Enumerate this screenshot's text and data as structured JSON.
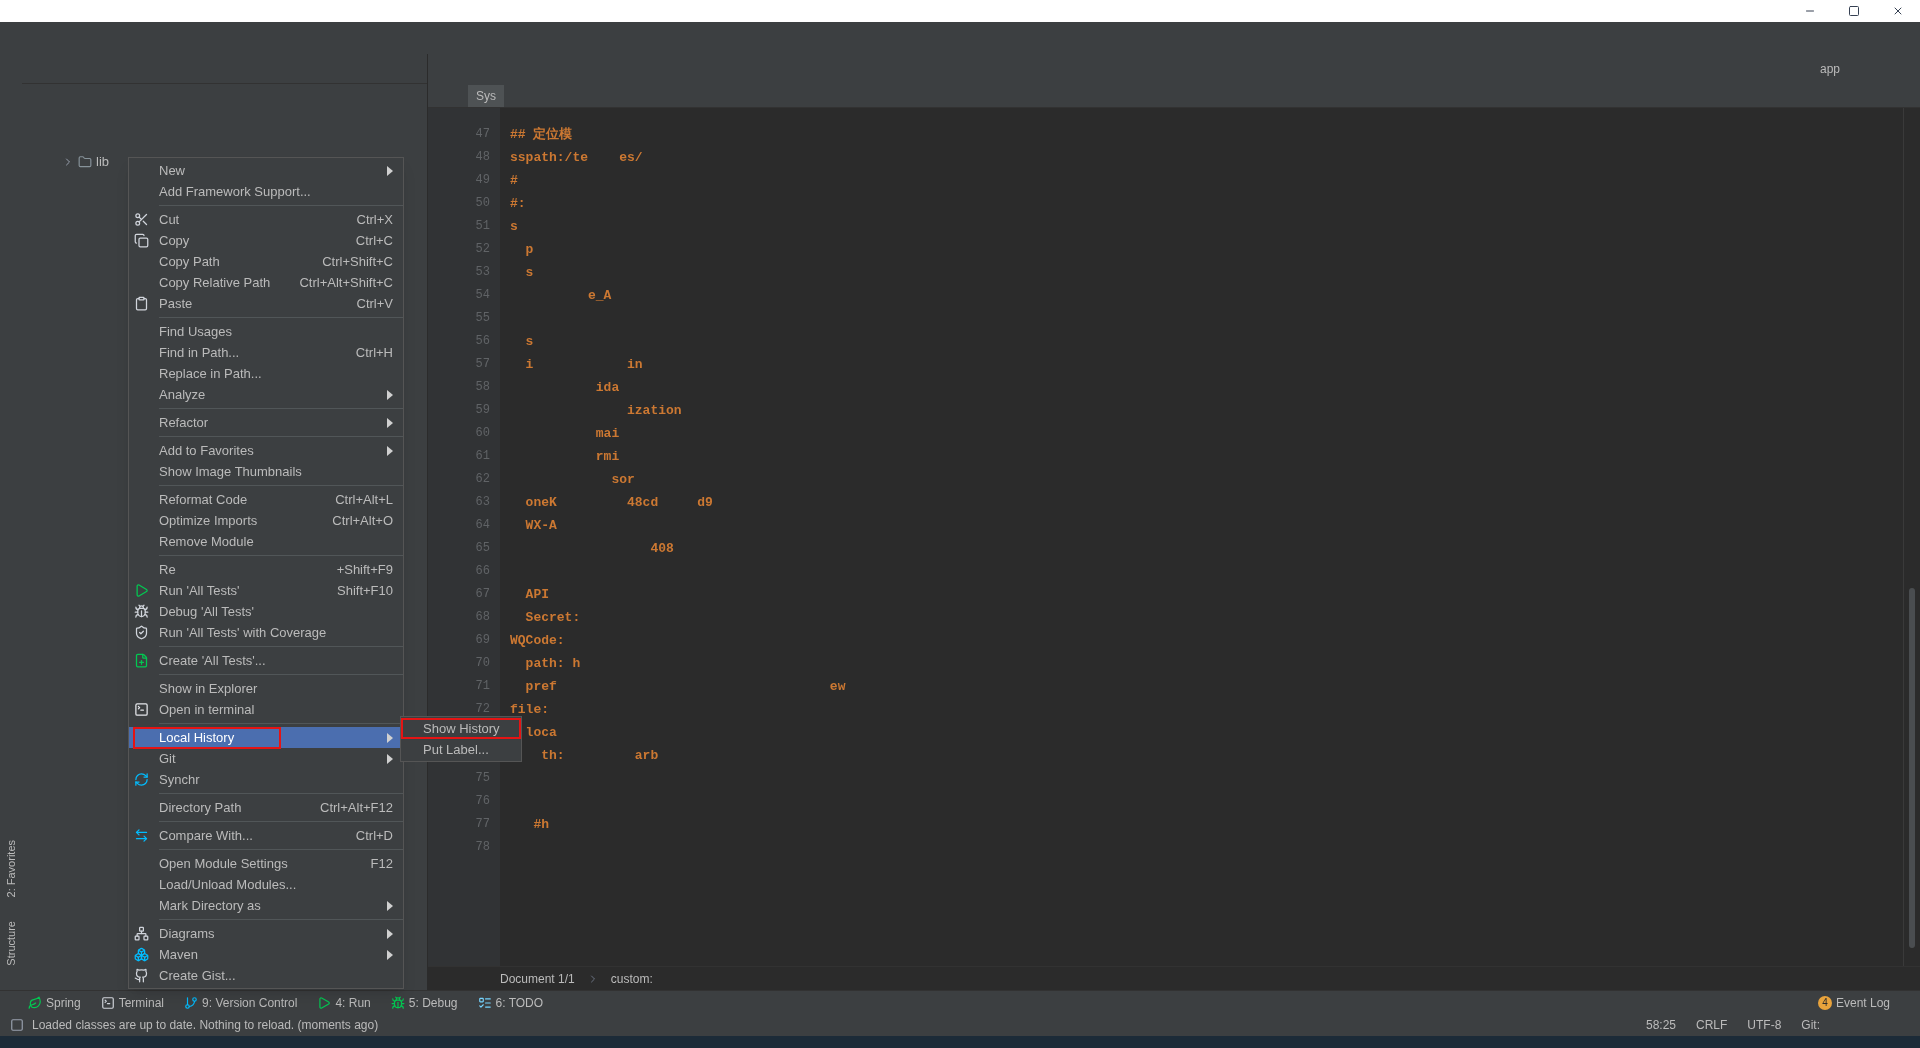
{
  "side_strip": [
    {
      "label": "2: Favorites"
    },
    {
      "label": "Structure"
    }
  ],
  "project_tree": [
    {
      "label": "lib",
      "expanded": false
    }
  ],
  "editor": {
    "tab": "Sys",
    "right_label": "app",
    "lines": [
      {
        "number": "47",
        "text": "## 定位模"
      },
      {
        "number": "48",
        "text": "sspath:/te    es/"
      },
      {
        "number": "49",
        "text": "#"
      },
      {
        "number": "50",
        "text": "#:"
      },
      {
        "number": "51",
        "text": "s"
      },
      {
        "number": "52",
        "text": "  p"
      },
      {
        "number": "53",
        "text": "  s"
      },
      {
        "number": "54",
        "text": "          e_A"
      },
      {
        "number": "55"
      },
      {
        "number": "56",
        "text": "  s"
      },
      {
        "number": "57",
        "text": "  i            in"
      },
      {
        "number": "58",
        "text": "           ida"
      },
      {
        "number": "59",
        "text": "               ization"
      },
      {
        "number": "60",
        "text": "           mai"
      },
      {
        "number": "61",
        "text": "           rmi"
      },
      {
        "number": "62",
        "text": "             sor"
      },
      {
        "number": "63",
        "text": "  oneK         48cd     d9"
      },
      {
        "number": "64",
        "text": "  WX-A"
      },
      {
        "number": "65",
        "text": "                  408"
      },
      {
        "number": "66"
      },
      {
        "number": "67",
        "text": "  API"
      },
      {
        "number": "68",
        "text": "  Secret:"
      },
      {
        "number": "69",
        "text": "WQCode:"
      },
      {
        "number": "70",
        "text": "  path: h"
      },
      {
        "number": "71",
        "text": "  pref                                   ew"
      },
      {
        "number": "72",
        "text": "file:"
      },
      {
        "text": "  loca"
      },
      {
        "text": "    th:         arb"
      },
      {
        "number": "75"
      },
      {
        "number": "76"
      },
      {
        "number": "77",
        "text": "   #h"
      },
      {
        "number": "78"
      }
    ],
    "breadcrumbs": [
      "Document 1/1",
      "custom:"
    ]
  },
  "context_menu": [
    {
      "kind": "item",
      "label": "New",
      "submenu": true,
      "selected": false,
      "marked": false
    },
    {
      "kind": "item",
      "label": "Add Framework Support...",
      "selected": false,
      "marked": false
    },
    {
      "kind": "separator"
    },
    {
      "kind": "item",
      "label": "Cut",
      "shortcut": "Ctrl+X",
      "selected": false,
      "marked": false
    },
    {
      "kind": "item",
      "label": "Copy",
      "shortcut": "Ctrl+C",
      "selected": false,
      "marked": false
    },
    {
      "kind": "item",
      "label": "Copy Path",
      "shortcut": "Ctrl+Shift+C",
      "selected": false,
      "marked": false
    },
    {
      "kind": "item",
      "label": "Copy Relative Path",
      "shortcut": "Ctrl+Alt+Shift+C",
      "selected": false,
      "marked": false
    },
    {
      "kind": "item",
      "label": "Paste",
      "shortcut": "Ctrl+V",
      "selected": false,
      "marked": false
    },
    {
      "kind": "separator"
    },
    {
      "kind": "item",
      "label": "Find Usages",
      "selected": false,
      "marked": false
    },
    {
      "kind": "item",
      "label": "Find in Path...",
      "shortcut": "Ctrl+H",
      "selected": false,
      "marked": false
    },
    {
      "kind": "item",
      "label": "Replace in Path...",
      "selected": false,
      "marked": false
    },
    {
      "kind": "item",
      "label": "Analyze",
      "submenu": true,
      "selected": false,
      "marked": false
    },
    {
      "kind": "separator"
    },
    {
      "kind": "item",
      "label": "Refactor",
      "submenu": true,
      "selected": false,
      "marked": false
    },
    {
      "kind": "separator"
    },
    {
      "kind": "item",
      "label": "Add to Favorites",
      "submenu": true,
      "selected": false,
      "marked": false
    },
    {
      "kind": "item",
      "label": "Show Image Thumbnails",
      "selected": false,
      "marked": false
    },
    {
      "kind": "separator"
    },
    {
      "kind": "item",
      "label": "Reformat Code",
      "shortcut": "Ctrl+Alt+L",
      "selected": false,
      "marked": false
    },
    {
      "kind": "item",
      "label": "Optimize Imports",
      "shortcut": "Ctrl+Alt+O",
      "selected": false,
      "marked": false
    },
    {
      "kind": "item",
      "label": "Remove Module",
      "selected": false,
      "marked": false
    },
    {
      "kind": "separator"
    },
    {
      "kind": "item",
      "label": "Re",
      "shortcut": "+Shift+F9",
      "selected": false,
      "marked": false
    },
    {
      "kind": "item",
      "label": "Run 'All Tests'",
      "shortcut": "Shift+F10",
      "selected": false,
      "marked": false
    },
    {
      "kind": "item",
      "label": "Debug 'All Tests'",
      "selected": false,
      "marked": false
    },
    {
      "kind": "item",
      "label": "Run 'All Tests' with Coverage",
      "selected": false,
      "marked": false
    },
    {
      "kind": "separator"
    },
    {
      "kind": "item",
      "label": "Create 'All Tests'...",
      "selected": false,
      "marked": false
    },
    {
      "kind": "separator"
    },
    {
      "kind": "item",
      "label": "Show in Explorer",
      "selected": false,
      "marked": false
    },
    {
      "kind": "item",
      "label": "Open in terminal",
      "selected": false,
      "marked": false
    },
    {
      "kind": "separator"
    },
    {
      "kind": "item",
      "label": "Local History",
      "submenu": true,
      "selected": true,
      "marked": true
    },
    {
      "kind": "item",
      "label": "Git",
      "submenu": true,
      "selected": false,
      "marked": false
    },
    {
      "kind": "item",
      "label": "Synchr",
      "selected": false,
      "marked": false
    },
    {
      "kind": "separator"
    },
    {
      "kind": "item",
      "label": "Directory Path",
      "shortcut": "Ctrl+Alt+F12",
      "selected": false,
      "marked": false
    },
    {
      "kind": "separator"
    },
    {
      "kind": "item",
      "label": "Compare With...",
      "shortcut": "Ctrl+D",
      "selected": false,
      "marked": false
    },
    {
      "kind": "separator"
    },
    {
      "kind": "item",
      "label": "Open Module Settings",
      "shortcut": "F12",
      "selected": false,
      "marked": false
    },
    {
      "kind": "item",
      "label": "Load/Unload Modules...",
      "selected": false,
      "marked": false
    },
    {
      "kind": "item",
      "label": "Mark Directory as",
      "submenu": true,
      "selected": false,
      "marked": false
    },
    {
      "kind": "separator"
    },
    {
      "kind": "item",
      "label": "Diagrams",
      "submenu": true,
      "selected": false,
      "marked": false
    },
    {
      "kind": "item",
      "label": "Maven",
      "submenu": true,
      "selected": false,
      "marked": false
    },
    {
      "kind": "item",
      "label": "Create Gist...",
      "selected": false,
      "marked": false
    }
  ],
  "submenu": [
    {
      "label": "Show History",
      "selected": false,
      "marked": true
    },
    {
      "label": "Put Label...",
      "selected": false,
      "marked": false
    }
  ],
  "tool_windows": [
    {
      "label": "Spring"
    },
    {
      "label": "Terminal"
    },
    {
      "label": "9: Version Control"
    },
    {
      "label": "4: Run"
    },
    {
      "label": "5: Debug"
    },
    {
      "label": "6: TODO"
    }
  ],
  "event_log": {
    "badge": "4",
    "label": "Event Log"
  },
  "status_bar": {
    "message": "Loaded classes are up to date. Nothing to reload. (moments ago)",
    "position": "58:25",
    "line_ending": "CRLF",
    "encoding": "UTF-8",
    "vcs": "Git:"
  }
}
